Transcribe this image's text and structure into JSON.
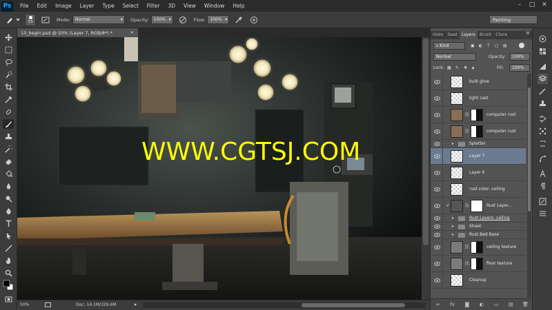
{
  "app": {
    "logo": "Ps"
  },
  "menu": [
    "File",
    "Edit",
    "Image",
    "Layer",
    "Type",
    "Select",
    "Filter",
    "3D",
    "View",
    "Window",
    "Help"
  ],
  "window_controls": [
    "–",
    "□",
    "✕"
  ],
  "options": {
    "brush_size": "33",
    "mode_label": "Mode:",
    "mode_value": "Normal",
    "opacity_label": "Opacity:",
    "opacity_value": "100%",
    "flow_label": "Flow:",
    "flow_value": "100%",
    "workspace": "Painting"
  },
  "document": {
    "tab_title": "13_begin.psd @ 50% (Layer 7, RGB/8*) *",
    "close": "×",
    "watermark": "WWW.CGTSJ.COM"
  },
  "status": {
    "zoom": "50%",
    "doc": "Doc: 14.1M/329.6M",
    "arrow": "▸"
  },
  "panel": {
    "tabs": [
      "Histo",
      "Swat",
      "Layers",
      "Brush",
      "Clone"
    ],
    "active_tab": "Layers",
    "filter_kind": "Kind",
    "blend_mode": "Normal",
    "opacity_label": "Opacity:",
    "opacity_value": "100%",
    "lock_label": "Lock:",
    "fill_label": "Fill:",
    "fill_value": "100%"
  },
  "layers": [
    {
      "name": "bulb glow",
      "kind": "pixel"
    },
    {
      "name": "light cast",
      "kind": "pixel"
    },
    {
      "name": "computer rust",
      "kind": "photo-mask"
    },
    {
      "name": "computer rust",
      "kind": "photo-mask"
    },
    {
      "name": "Splatter",
      "kind": "group"
    },
    {
      "name": "Layer 7",
      "kind": "pixel",
      "selected": true
    },
    {
      "name": "Layer 6",
      "kind": "pixel"
    },
    {
      "name": "rust color- ceiling",
      "kind": "pixel"
    },
    {
      "name": "Rust Layer...",
      "kind": "adjust-clip"
    },
    {
      "name": "Rust Layers- ceiling",
      "kind": "group",
      "underlined": true
    },
    {
      "name": "Sheet",
      "kind": "group"
    },
    {
      "name": "Rust Bed Base",
      "kind": "group"
    },
    {
      "name": "ceiling texture",
      "kind": "photo-mask2"
    },
    {
      "name": "floor texture",
      "kind": "photo-mask2"
    },
    {
      "name": "Cleanup",
      "kind": "pixel"
    }
  ],
  "layer_footer": [
    "∞",
    "fx",
    "◙",
    "◐",
    "▭",
    "▤",
    "🗑"
  ],
  "colors": {
    "menubar": "#2b2b2b",
    "panel": "#535353",
    "selected_layer": "#6a7b91",
    "watermark": "#ffff00"
  }
}
